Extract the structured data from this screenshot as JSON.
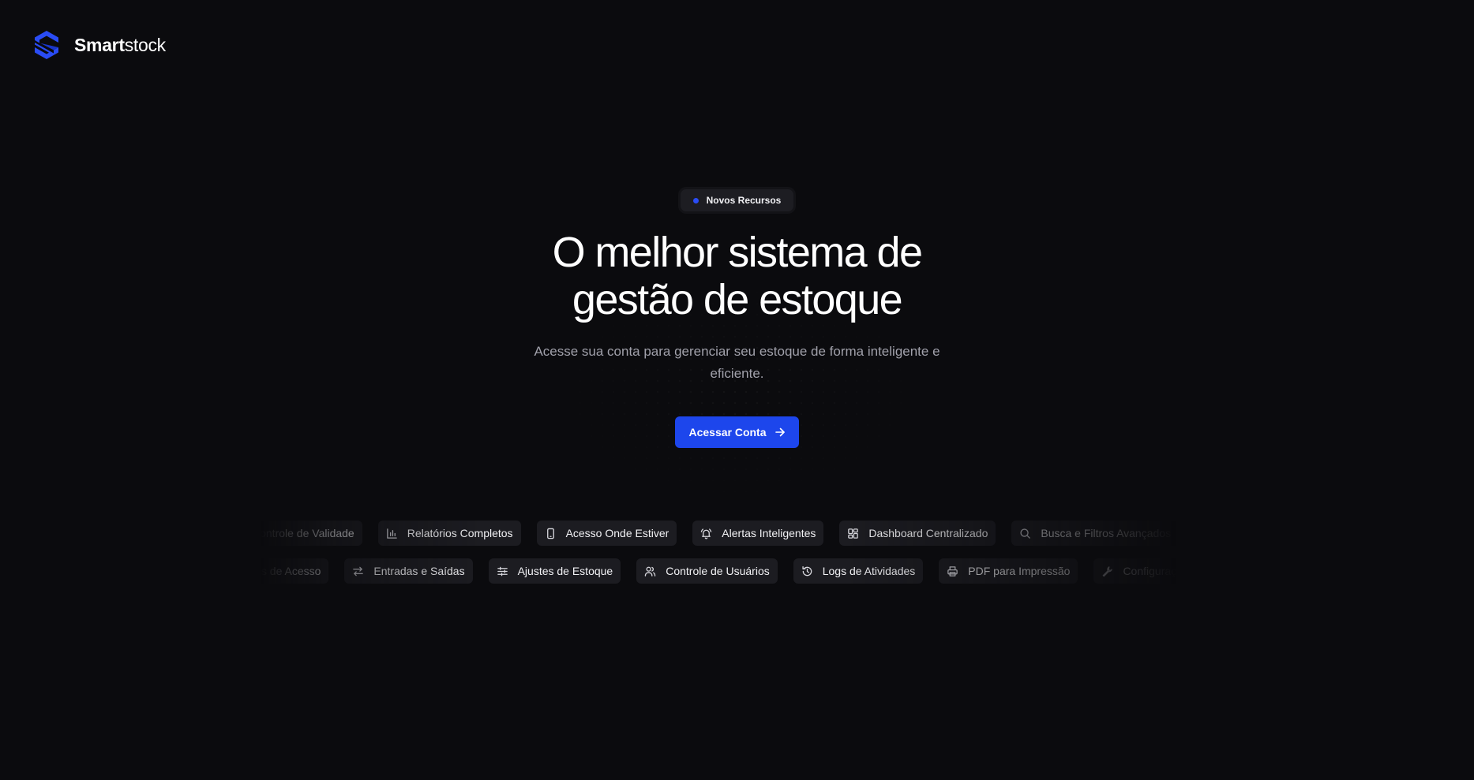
{
  "brand": {
    "name_strong": "Smart",
    "name_light": "stock",
    "logo_icon": "smartstock-s-logo-icon",
    "accent_color": "#1d46ec"
  },
  "hero": {
    "badge": "Novos Recursos",
    "headline_line1": "O melhor sistema de",
    "headline_line2": "gestão de estoque",
    "subtitle": "Acesse sua conta para gerenciar seu estoque de forma inteligente e eficiente.",
    "cta_label": "Acessar Conta",
    "cta_icon": "arrow-right-icon"
  },
  "features_row1": [
    {
      "label": "Controle de Validade",
      "icon": "calendar-icon"
    },
    {
      "label": "Relatórios Completos",
      "icon": "bar-chart-icon"
    },
    {
      "label": "Acesso Onde Estiver",
      "icon": "smartphone-icon"
    },
    {
      "label": "Alertas Inteligentes",
      "icon": "bell-icon"
    },
    {
      "label": "Dashboard Centralizado",
      "icon": "dashboard-icon"
    },
    {
      "label": "Busca e Filtros Avançados",
      "icon": "search-icon"
    }
  ],
  "features_row2": [
    {
      "label": "Níveis de Acesso",
      "icon": "shield-icon"
    },
    {
      "label": "Entradas e Saídas",
      "icon": "arrows-swap-icon"
    },
    {
      "label": "Ajustes de Estoque",
      "icon": "sliders-icon"
    },
    {
      "label": "Controle de Usuários",
      "icon": "users-icon"
    },
    {
      "label": "Logs de Atividades",
      "icon": "history-icon"
    },
    {
      "label": "PDF para Impressão",
      "icon": "printer-icon"
    },
    {
      "label": "Configurações",
      "icon": "wrench-icon"
    }
  ]
}
